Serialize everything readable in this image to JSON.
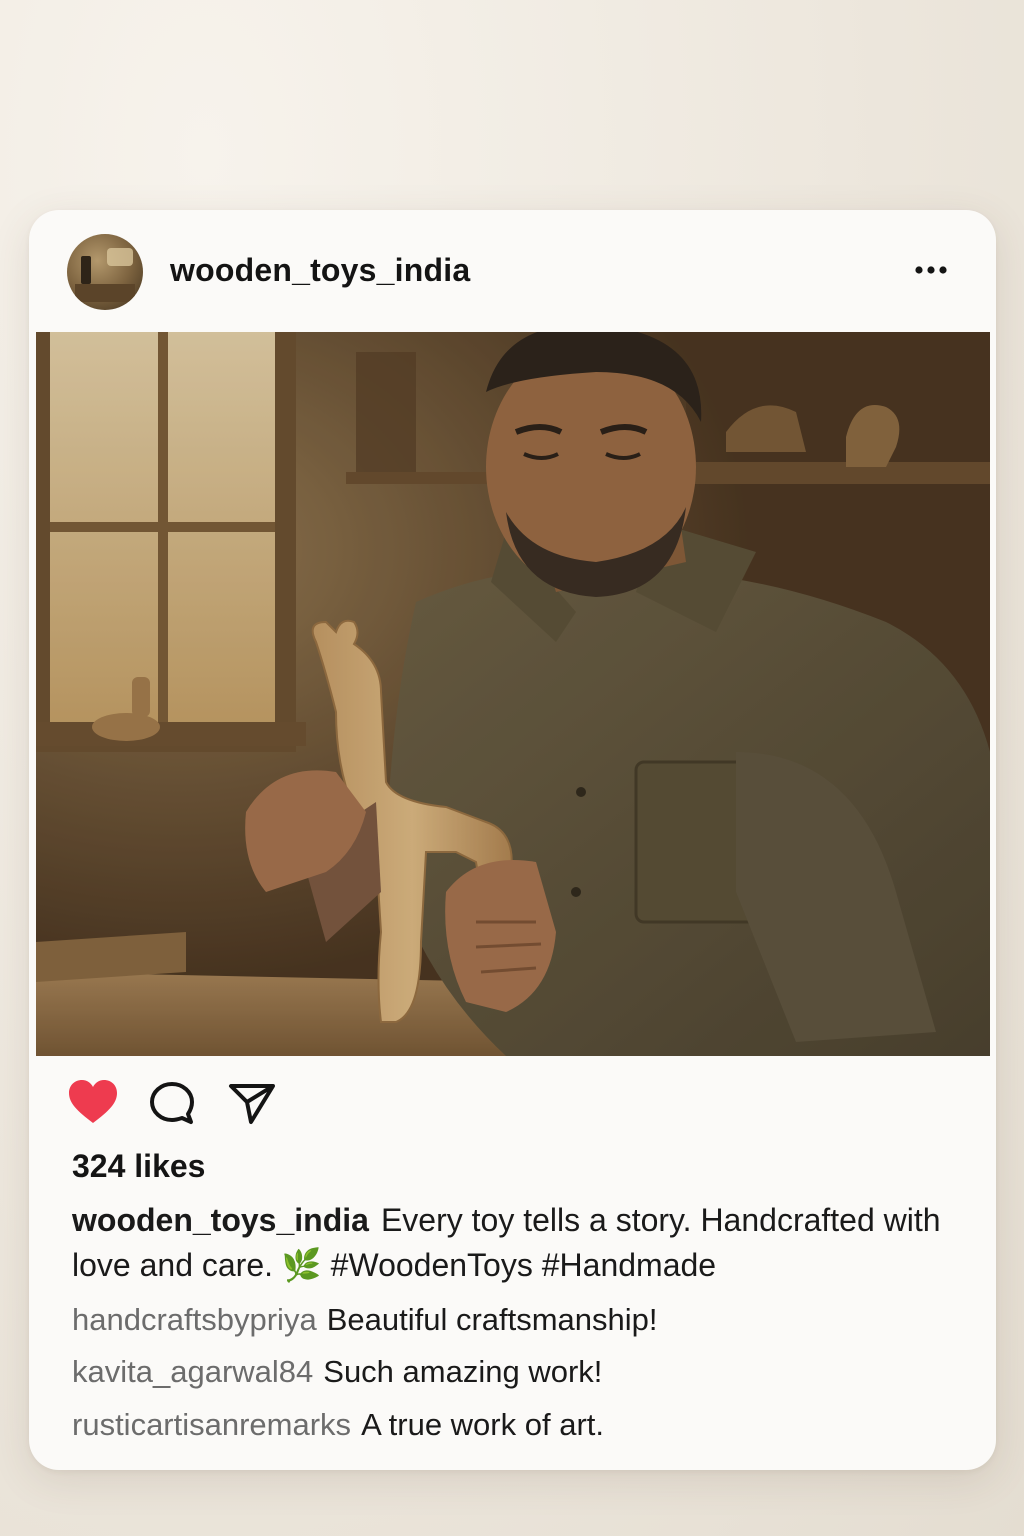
{
  "post": {
    "username": "wooden_toys_india",
    "likes_text": "324 likes",
    "liked": true,
    "like_color": "#ee3b4f",
    "caption": {
      "username": "wooden_toys_india",
      "text": "Every toy tells a story. Handcrafted with love and care. 🌿 #WoodenToys #Handmade"
    },
    "comments": [
      {
        "username": "handcraftsbypriya",
        "text": "Beautiful craftsmanship!"
      },
      {
        "username": "kavita_agarwal84",
        "text": "Such amazing work!"
      },
      {
        "username": "rusticartisanremarks",
        "text": "A true work of art."
      }
    ]
  },
  "icons": {
    "more": "more-horizontal-icon",
    "like": "heart-icon",
    "comment": "comment-bubble-icon",
    "share": "send-paper-plane-icon"
  }
}
